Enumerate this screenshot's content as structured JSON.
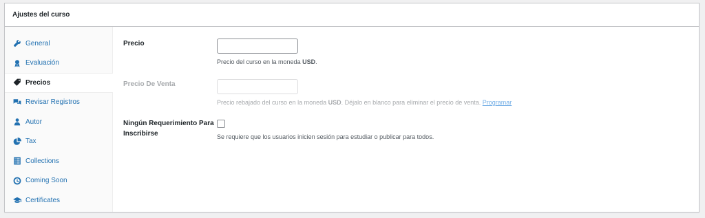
{
  "metabox": {
    "title": "Ajustes del curso"
  },
  "tabs": [
    {
      "label": "General",
      "icon": "wrench-icon"
    },
    {
      "label": "Evaluación",
      "icon": "award-icon"
    },
    {
      "label": "Precios",
      "icon": "tag-icon"
    },
    {
      "label": "Revisar Registros",
      "icon": "chat-icon"
    },
    {
      "label": "Autor",
      "icon": "user-icon"
    },
    {
      "label": "Tax",
      "icon": "pie-chart-icon"
    },
    {
      "label": "Collections",
      "icon": "list-icon"
    },
    {
      "label": "Coming Soon",
      "icon": "clock-icon"
    },
    {
      "label": "Certificates",
      "icon": "graduation-cap-icon"
    }
  ],
  "active_tab": "Precios",
  "fields": {
    "price": {
      "label": "Precio",
      "value": "",
      "desc_prefix": "Precio del curso en la moneda ",
      "desc_currency": "USD",
      "desc_suffix": "."
    },
    "sale_price": {
      "label": "Precio De Venta",
      "value": "",
      "desc_prefix": "Precio rebajado del curso en la moneda ",
      "desc_currency": "USD",
      "desc_suffix": ". Déjalo en blanco para eliminar el precio de venta. ",
      "schedule_link": "Programar"
    },
    "no_requirement": {
      "label_line1": "Ningún Requerimiento Para",
      "label_line2": "Inscribirse",
      "checked": false,
      "desc": "Se requiere que los usuarios inicien sesión para estudiar o publicar para todos."
    }
  },
  "colors": {
    "link": "#2271b1",
    "disabled_text": "#a7aaad",
    "border": "#c3c4c7"
  }
}
